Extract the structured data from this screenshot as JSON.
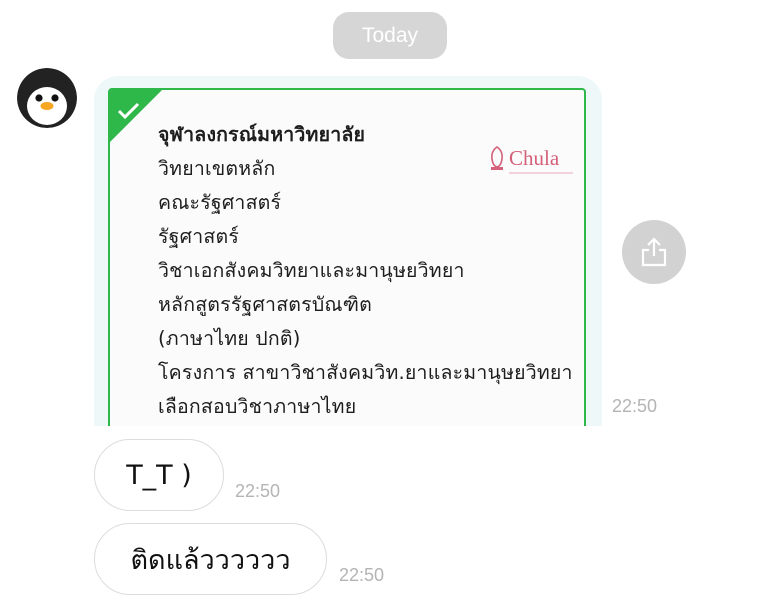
{
  "date_divider": "Today",
  "messages": [
    {
      "type": "image",
      "image_text": {
        "lines": [
          "จุฬาลงกรณ์มหาวิทยาลัย",
          "วิทยาเขตหลัก",
          "คณะรัฐศาสตร์",
          "รัฐศาสตร์",
          "วิชาเอกสังคมวิทยาและมานุษยวิทยา",
          "หลักสูตรรัฐศาสตรบัณฑิต",
          "(ภาษาไทย ปกติ)",
          "โครงการ สาขาวิชาสังคมวิท.ยาและมานุษยวิทยา",
          "เลือกสอบวิชาภาษาไทย"
        ],
        "logo_text": "Chula"
      },
      "time": "22:50"
    },
    {
      "type": "text",
      "text": "T_T )",
      "time": "22:50"
    },
    {
      "type": "text",
      "text": "ติดแล้วววววว",
      "time": "22:50"
    }
  ],
  "icons": {
    "avatar": "penguin-avatar-icon",
    "share": "share-icon",
    "verified": "checkmark-icon"
  },
  "colors": {
    "card_border": "#2fb84a",
    "card_bubble_bg": "#eef8f8",
    "date_pill_bg": "#d6d6d6",
    "share_button_bg": "#d2d2d2",
    "timestamp": "#b4b4b4"
  }
}
